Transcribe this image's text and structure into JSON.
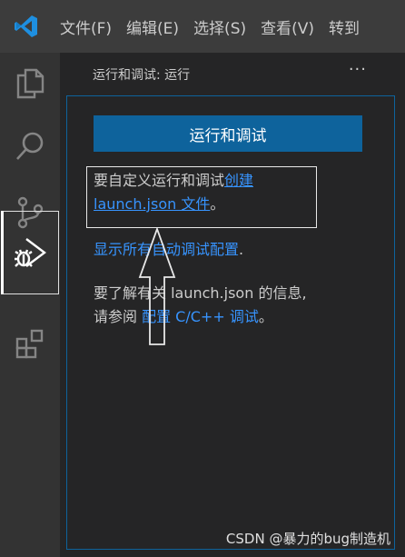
{
  "menubar": {
    "items": [
      "文件(F)",
      "编辑(E)",
      "选择(S)",
      "查看(V)",
      "转到"
    ]
  },
  "activitybar": {
    "icons": [
      "explorer-icon",
      "search-icon",
      "source-control-icon",
      "run-debug-icon",
      "extensions-icon"
    ]
  },
  "sidebar": {
    "header": "运行和调试: 运行",
    "more": "···",
    "run_button_label": "运行和调试",
    "customize_text": "要自定义运行和调试",
    "create_link_1": "创建",
    "create_link_2": "launch.json 文件",
    "customize_end": "。",
    "show_all_link": "显示所有自动调试配置",
    "show_all_end": ".",
    "learn_more_1": "要了解有关 launch.json 的信息,",
    "learn_more_2": "请参阅 ",
    "config_link": "配置 C/C++ 调试",
    "learn_more_end": "。"
  },
  "watermark": "CSDN @暴力的bug制造机",
  "colors": {
    "accent": "#0e639c",
    "link": "#3794ff",
    "menubar_bg": "#3c3c3c",
    "activitybar_bg": "#333333",
    "sidebar_bg": "#252526"
  }
}
